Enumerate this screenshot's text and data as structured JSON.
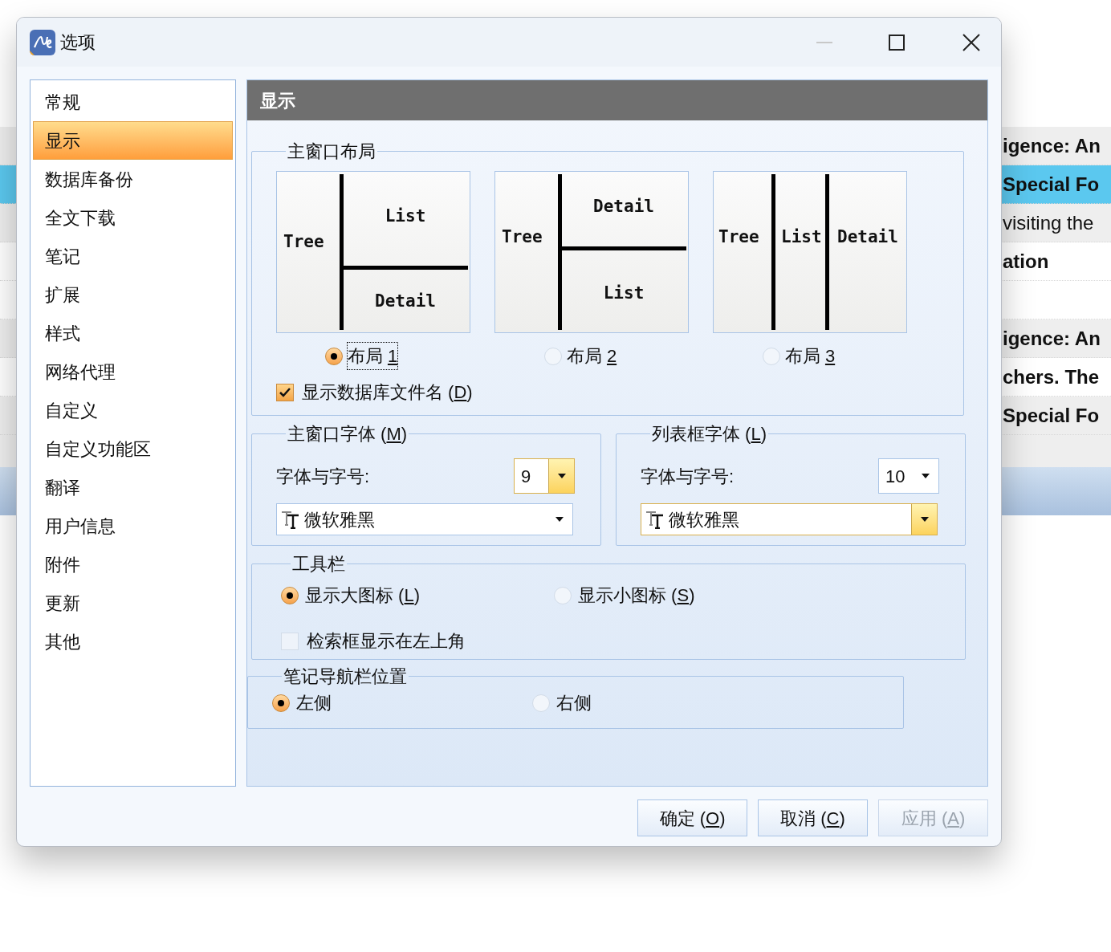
{
  "background": {
    "rows": [
      {
        "text": "igence: An",
        "bold": true,
        "selected": false
      },
      {
        "text": "Special Fo",
        "bold": true,
        "selected": true
      },
      {
        "text": "visiting the",
        "bold": false,
        "selected": false
      },
      {
        "text": "ation",
        "bold": true,
        "selected": false
      },
      {
        "text": "igence: An",
        "bold": true,
        "selected": false,
        "gap_before": true
      },
      {
        "text": "chers. The",
        "bold": true,
        "selected": false
      },
      {
        "text": "Special Fo",
        "bold": true,
        "selected": false
      }
    ]
  },
  "window": {
    "title": "选项"
  },
  "sidebar": {
    "items": [
      {
        "label": "常规",
        "selected": false
      },
      {
        "label": "显示",
        "selected": true
      },
      {
        "label": "数据库备份",
        "selected": false
      },
      {
        "label": "全文下载",
        "selected": false
      },
      {
        "label": "笔记",
        "selected": false
      },
      {
        "label": "扩展",
        "selected": false
      },
      {
        "label": "样式",
        "selected": false
      },
      {
        "label": "网络代理",
        "selected": false
      },
      {
        "label": "自定义",
        "selected": false
      },
      {
        "label": "自定义功能区",
        "selected": false
      },
      {
        "label": "翻译",
        "selected": false
      },
      {
        "label": "用户信息",
        "selected": false
      },
      {
        "label": "附件",
        "selected": false
      },
      {
        "label": "更新",
        "selected": false
      },
      {
        "label": "其他",
        "selected": false
      }
    ]
  },
  "panel": {
    "title": "显示"
  },
  "layout_group": {
    "title": "主窗口布局",
    "options": [
      {
        "label": "布局 ",
        "access_key": "1",
        "selected": true,
        "diagram": {
          "kind": "split",
          "panes": [
            "Tree",
            "List",
            "Detail"
          ]
        }
      },
      {
        "label": "布局 ",
        "access_key": "2",
        "selected": false,
        "diagram": {
          "kind": "split",
          "panes": [
            "Tree",
            "Detail",
            "List"
          ]
        }
      },
      {
        "label": "布局 ",
        "access_key": "3",
        "selected": false,
        "diagram": {
          "kind": "columns",
          "panes": [
            "Tree",
            "List",
            "Detail"
          ]
        }
      }
    ],
    "checkbox": {
      "label": "显示数据库文件名 (",
      "access_key": "D",
      "label_end": ")",
      "checked": true
    }
  },
  "font_groups": [
    {
      "title": "主窗口字体 (",
      "access_key": "M",
      "title_end": ")",
      "label": "字体与字号:",
      "size": "9",
      "size_highlighted": true,
      "font": "微软雅黑",
      "font_highlighted": false
    },
    {
      "title": "列表框字体 (",
      "access_key": "L",
      "title_end": ")",
      "label": "字体与字号:",
      "size": "10",
      "size_highlighted": false,
      "font": "微软雅黑",
      "font_highlighted": true
    }
  ],
  "toolbar_group": {
    "title": "工具栏",
    "radios": [
      {
        "label": "显示大图标 (",
        "access_key": "L",
        "label_end": ")",
        "selected": true
      },
      {
        "label": "显示小图标 (",
        "access_key": "S",
        "label_end": ")",
        "selected": false
      }
    ],
    "checkbox": {
      "label": "检索框显示在左上角",
      "checked": false
    }
  },
  "notes_group": {
    "title": "笔记导航栏位置",
    "radios": [
      {
        "label": "左侧",
        "selected": true
      },
      {
        "label": "右侧",
        "selected": false
      }
    ]
  },
  "buttons": [
    {
      "label": "确定 (",
      "access_key": "O",
      "label_end": ")",
      "disabled": false
    },
    {
      "label": "取消 (",
      "access_key": "C",
      "label_end": ")",
      "disabled": false
    },
    {
      "label": "应用 (",
      "access_key": "A",
      "label_end": ")",
      "disabled": true
    }
  ]
}
